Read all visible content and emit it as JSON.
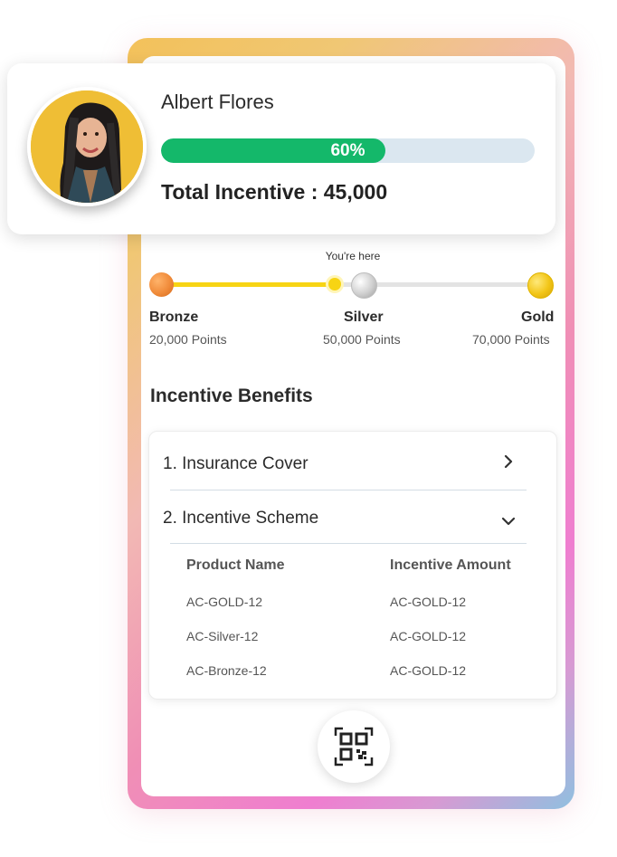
{
  "user": {
    "name": "Albert Flores",
    "progress_percent": 60,
    "progress_label": "60%",
    "total_incentive": "Total Incentive : 45,000"
  },
  "tiers": {
    "you_are_here": "You're here",
    "current_progress_fraction": 0.66,
    "items": [
      {
        "name": "Bronze",
        "points": "20,000 Points",
        "color": "#f08b3a"
      },
      {
        "name": "Silver",
        "points": "50,000 Points",
        "color": "#c8c8c8"
      },
      {
        "name": "Gold",
        "points": "70,000 Points",
        "color": "#f2c516"
      }
    ]
  },
  "benefits": {
    "title": "Incentive Benefits",
    "items": [
      {
        "label": "1. Insurance Cover",
        "state": "collapsed"
      },
      {
        "label": "2. Incentive Scheme",
        "state": "expanded"
      }
    ],
    "table": {
      "headers": [
        "Product Name",
        "Incentive Amount"
      ],
      "rows": [
        [
          "AC-GOLD-12",
          "AC-GOLD-12"
        ],
        [
          "AC-Silver-12",
          "AC-GOLD-12"
        ],
        [
          "AC-Bronze-12",
          "AC-GOLD-12"
        ]
      ]
    }
  },
  "actions": {
    "qr_icon": "qr-code-icon"
  },
  "colors": {
    "progress_fill": "#14b86a",
    "progress_track": "#dbe7f0",
    "tier_active": "#f7d414",
    "tier_inactive": "#e3e3e3"
  }
}
